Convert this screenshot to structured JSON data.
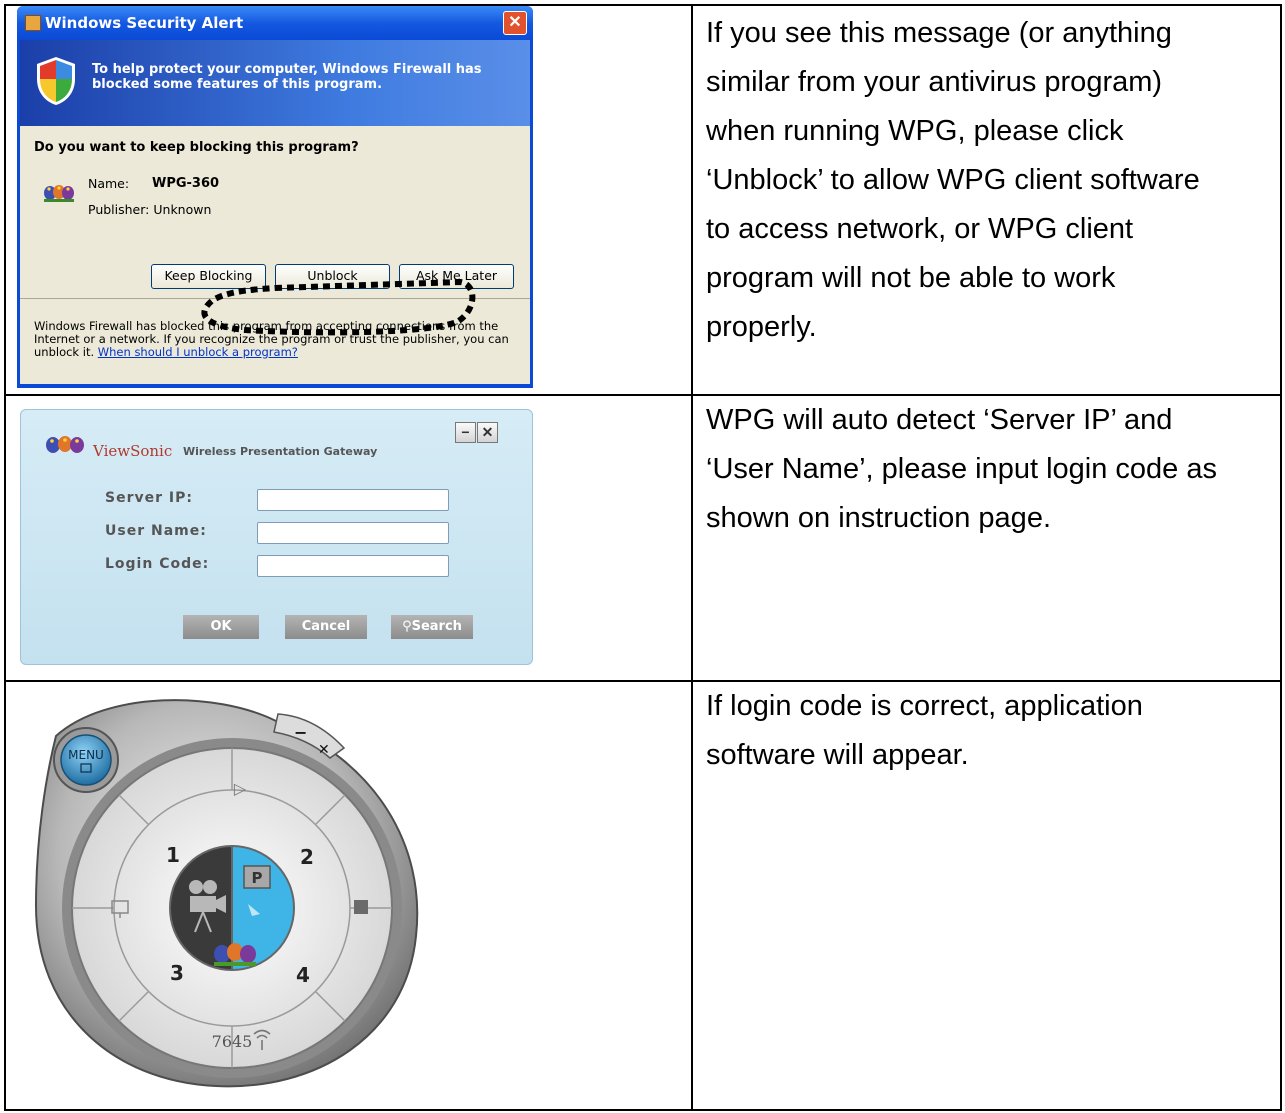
{
  "rows": [
    {
      "description": "If you see this message (or anything similar from your antivirus program) when running WPG, please click ‘Unblock’ to allow WPG client software to access network, or WPG client program will not be able to work properly.",
      "description_lines": [
        "If you see this message (or anything",
        "similar from your antivirus program)",
        "when running WPG, please click",
        "‘Unblock’ to allow WPG client software",
        "to access network, or WPG client",
        "program will not be able to work",
        "properly."
      ]
    },
    {
      "description_lines": [
        "WPG will auto detect ‘Server IP’ and",
        "‘User Name’, please input login code as",
        "shown on instruction page."
      ]
    },
    {
      "description_lines": [
        "If login code is correct, application",
        "software will appear."
      ]
    }
  ],
  "security_alert": {
    "title": "Windows Security Alert",
    "close_glyph": "✕",
    "banner_text": "To help protect your computer,  Windows Firewall has blocked some features of this program.",
    "question": "Do you want to keep blocking this program?",
    "name_label": "Name:",
    "name_value": "WPG-360",
    "publisher_label": "Publisher:",
    "publisher_value": "Unknown",
    "buttons": {
      "keep_blocking": "Keep Blocking",
      "unblock": "Unblock",
      "ask_later": "Ask Me Later"
    },
    "footer_text": "Windows Firewall has blocked this program from accepting connections from the Internet or a network. If you recognize the program or trust the publisher, you can unblock it.",
    "footer_link": "When should I unblock a program?"
  },
  "login_window": {
    "brand": "ViewSonic",
    "subtitle": "Wireless Presentation Gateway",
    "minimize_glyph": "−",
    "close_glyph": "✕",
    "labels": {
      "server_ip": "Server IP:",
      "user_name": "User Name:",
      "login_code": "Login Code:"
    },
    "values": {
      "server_ip": "",
      "user_name": "",
      "login_code": ""
    },
    "buttons": {
      "ok": "OK",
      "cancel": "Cancel",
      "search": "Search"
    }
  },
  "dial_app": {
    "menu_label": "MENU",
    "minimize_glyph": "−",
    "close_glyph": "✕",
    "play_glyph": "▷",
    "quadrants": [
      "1",
      "2",
      "3",
      "4"
    ],
    "p_label": "P",
    "code": "7645",
    "colors": {
      "blue": "#3fb4e6",
      "dark": "#3a3a3a"
    }
  }
}
